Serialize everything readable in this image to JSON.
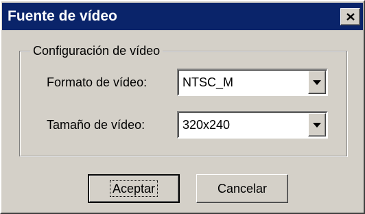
{
  "window": {
    "title": "Fuente de vídeo",
    "close_icon": "close-x"
  },
  "group": {
    "label": "Configuración de vídeo"
  },
  "format": {
    "label": "Formato de vídeo:",
    "value": "NTSC_M",
    "icon": "chevron-down"
  },
  "size": {
    "label": "Tamaño de vídeo:",
    "value": "320x240",
    "icon": "chevron-down"
  },
  "buttons": {
    "ok_label": "Aceptar",
    "cancel_label": "Cancelar"
  },
  "colors": {
    "titlebar": "#0a246a",
    "face": "#d4d0c8"
  }
}
